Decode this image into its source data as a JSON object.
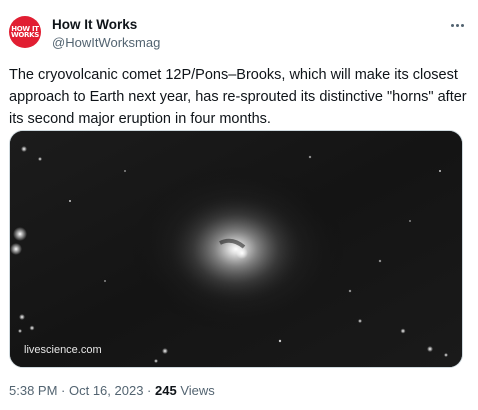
{
  "author": {
    "display_name": "How It Works",
    "handle": "@HowItWorksmag",
    "avatar": {
      "line1": "HOW IT",
      "line2": "WORKS",
      "color": "#e11e32"
    }
  },
  "more_icon": "more-horizontal-icon",
  "tweet": {
    "text": "The cryovolcanic comet 12P/Pons–Brooks, which will make its closest approach to Earth next year, has re-sprouted its distinctive \"horns\" after its second major eruption in four months."
  },
  "media": {
    "watermark": "livescience.com"
  },
  "meta": {
    "time": "5:38 PM",
    "separator1": " · ",
    "date": "Oct 16, 2023",
    "separator2": " · ",
    "views_count": "245",
    "views_label": " Views"
  },
  "colors": {
    "text_primary": "#0f1419",
    "text_secondary": "#536471",
    "brand_red": "#e11e32",
    "border": "#cfd9de"
  }
}
